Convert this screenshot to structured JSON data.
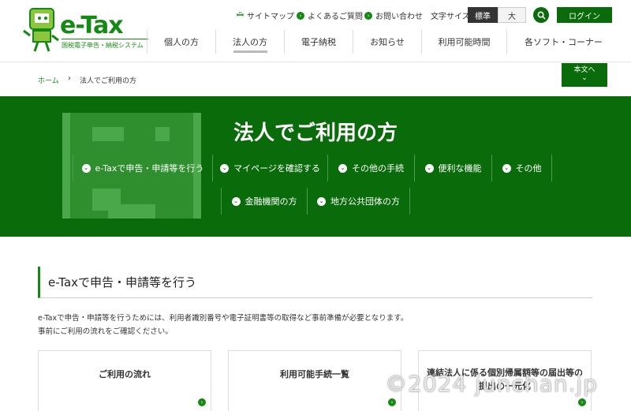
{
  "header": {
    "logo_text": "e-Tax",
    "logo_sub": "国税電子申告・納税システム",
    "links": [
      {
        "label": "サイトマップ",
        "icon": "sitemap-icon"
      },
      {
        "label": "よくあるご質問",
        "icon": "chevron-right-circle-icon"
      },
      {
        "label": "お問い合わせ",
        "icon": "chevron-right-circle-icon"
      }
    ],
    "font_size_label": "文字サイズ",
    "font_size_options": [
      "標準",
      "大"
    ],
    "font_size_selected": "標準",
    "login_label": "ログイン"
  },
  "nav": {
    "items": [
      "個人の方",
      "法人の方",
      "電子納税",
      "お知らせ",
      "利用可能時間",
      "各ソフト・コーナー"
    ],
    "active": "法人の方"
  },
  "breadcrumb": {
    "home": "ホーム",
    "current": "法人でご利用の方"
  },
  "skip_button": {
    "line1": "本文へ",
    "line2": "⌄"
  },
  "hero": {
    "title": "法人でご利用の方",
    "links_row1": [
      "e-Taxで申告・申請等を行う",
      "マイページを確認する",
      "その他の手続",
      "便利な機能",
      "その他"
    ],
    "links_row2": [
      "金融機関の方",
      "地方公共団体の方"
    ]
  },
  "section": {
    "title": "e-Taxで申告・申請等を行う",
    "desc1": "e-Taxで申告・申請等を行うためには、利用者識別番号や電子証明書等の取得など事前準備が必要となります。",
    "desc2": "事前にご利用の流れをご確認ください。"
  },
  "cards": [
    {
      "title": "ご利用の流れ"
    },
    {
      "title": "利用可能手続一覧"
    },
    {
      "title": "連結法人に係る個別帰属額等の届出等の提出の一元化"
    }
  ],
  "watermark": "©2024 junchan.jp",
  "colors": {
    "primary": "#0a6b0a",
    "accent": "#148a14",
    "hero_deco": "#2f8f2f"
  }
}
